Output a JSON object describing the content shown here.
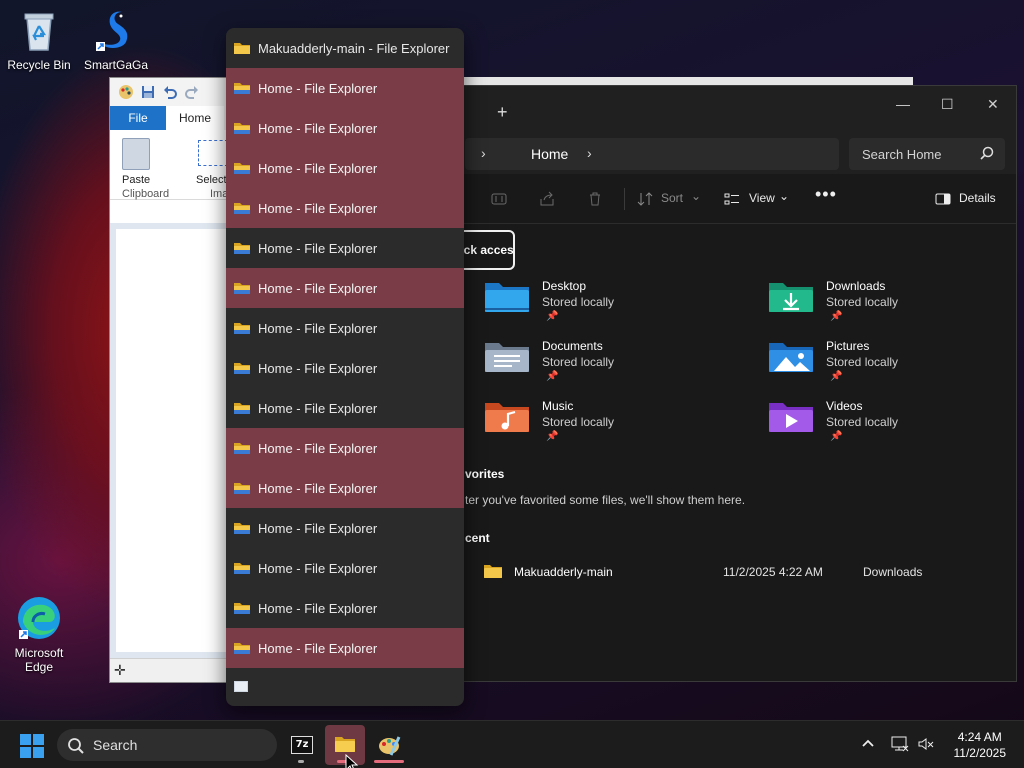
{
  "desktop": {
    "icons": [
      {
        "label": "Recycle Bin",
        "icon": "recycle-bin-icon"
      },
      {
        "label": "SmartGaGa",
        "icon": "smartgaga-icon"
      },
      {
        "label": "Microsoft\nEdge",
        "icon": "edge-icon"
      }
    ]
  },
  "paint": {
    "tab_file": "File",
    "tab_home": "Home",
    "paste_label": "Paste",
    "select_label": "Select",
    "clipboard_group": "Clipboard",
    "image_group": "Ima"
  },
  "jumplist": {
    "top_title": "Makuadderly-main - File Explorer",
    "items": [
      {
        "title": "Home - File Explorer",
        "highlight": true
      },
      {
        "title": "Home - File Explorer",
        "highlight": true
      },
      {
        "title": "Home - File Explorer",
        "highlight": true
      },
      {
        "title": "Home - File Explorer",
        "highlight": true
      },
      {
        "title": "Home - File Explorer",
        "highlight": false
      },
      {
        "title": "Home - File Explorer",
        "highlight": true
      },
      {
        "title": "Home - File Explorer",
        "highlight": false
      },
      {
        "title": "Home - File Explorer",
        "highlight": false
      },
      {
        "title": "Home - File Explorer",
        "highlight": false
      },
      {
        "title": "Home - File Explorer",
        "highlight": true
      },
      {
        "title": "Home - File Explorer",
        "highlight": true
      },
      {
        "title": "Home - File Explorer",
        "highlight": false
      },
      {
        "title": "Home - File Explorer",
        "highlight": false
      },
      {
        "title": "Home - File Explorer",
        "highlight": false
      },
      {
        "title": "Home - File Explorer",
        "highlight": true
      }
    ]
  },
  "explorer": {
    "new_tab": "+",
    "address": {
      "crumb": "Home"
    },
    "search": {
      "placeholder": "Search Home"
    },
    "toolbar": {
      "sort": "Sort",
      "view": "View",
      "more": "•••",
      "details": "Details"
    },
    "quick_access_label": "uick access",
    "quick_items": [
      {
        "name": "Desktop",
        "sub": "Stored locally",
        "icon": "desktop-folder-icon"
      },
      {
        "name": "Downloads",
        "sub": "Stored locally",
        "icon": "downloads-folder-icon"
      },
      {
        "name": "Documents",
        "sub": "Stored locally",
        "icon": "documents-folder-icon"
      },
      {
        "name": "Pictures",
        "sub": "Stored locally",
        "icon": "pictures-folder-icon"
      },
      {
        "name": "Music",
        "sub": "Stored locally",
        "icon": "music-folder-icon"
      },
      {
        "name": "Videos",
        "sub": "Stored locally",
        "icon": "videos-folder-icon"
      }
    ],
    "favorites_header": "vorites",
    "favorites_message": "ter you've favorited some files, we'll show them here.",
    "recent_header": "cent",
    "recent": [
      {
        "name": "Makuadderly-main",
        "date": "11/2/2025 4:22 AM",
        "location": "Downloads"
      }
    ]
  },
  "taskbar": {
    "search_placeholder": "Search",
    "sevenzip_label": "7z",
    "time": "4:24 AM",
    "date": "11/2/2025"
  },
  "colors": {
    "highlight_row": "#7a3d47",
    "explorer_bg": "#191919",
    "taskbar_bg": "#1c1c1c",
    "accent_blue": "#1e73c8"
  }
}
